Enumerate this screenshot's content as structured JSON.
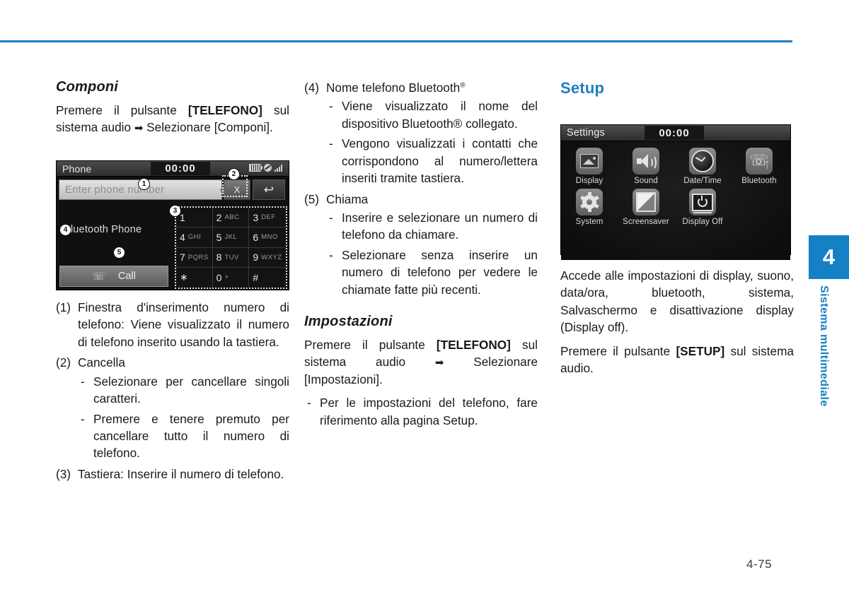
{
  "page": {
    "number": "4-75",
    "accent_color": "#1f7fc0"
  },
  "chapter_tab": {
    "number": "4",
    "label": "Sistema multimediale"
  },
  "col1": {
    "heading": "Componi",
    "intro_1": "Premere il pulsante ",
    "intro_bold": "[TELEFONO]",
    "intro_2": " sul sistema audio ",
    "intro_arrow": "➡",
    "intro_3": " Selezionare [Componi].",
    "items": [
      {
        "marker": "(1)",
        "text": "Finestra d'inserimento numero di telefono: Viene visualizzato il numero di telefono inserito usando la tastiera."
      },
      {
        "marker": "(2)",
        "text": "Cancella",
        "subitems": [
          "Selezionare per cancellare singoli caratteri.",
          "Premere e tenere premuto per cancellare tutto il numero di telefono."
        ]
      },
      {
        "marker": "(3)",
        "text": "Tastiera: Inserire il numero di telefono."
      }
    ]
  },
  "col2": {
    "items": [
      {
        "marker": "(4)",
        "text": "Nome telefono Bluetooth",
        "sup": "®",
        "subitems": [
          "Viene visualizzato il nome del dispositivo Bluetooth® collegato.",
          "Vengono visualizzati i contatti che corrispondono al numero/lettera inseriti tramite tastiera."
        ]
      },
      {
        "marker": "(5)",
        "text": "Chiama",
        "subitems": [
          "Inserire e selezionare un numero di telefono da chiamare.",
          "Selezionare senza inserire un numero di telefono per vedere le chiamate fatte più recenti."
        ]
      }
    ],
    "heading": "Impostazioni",
    "intro_1": "Premere il pulsante ",
    "intro_bold": "[TELEFONO]",
    "intro_2": " sul sistema audio ",
    "intro_arrow": "➡",
    "intro_3": " Selezionare [Impostazioni].",
    "dash_note": "Per le impostazioni del telefono, fare riferimento alla pagina Setup."
  },
  "col3": {
    "heading": "Setup",
    "para_1": "Accede alle impostazioni di display, suono, data/ora, bluetooth, sistema, Salvaschermo e disattivazione display (Display off).",
    "para_2a": "Premere il pulsante ",
    "para_2bold": "[SETUP]",
    "para_2b": " sul sistema audio."
  },
  "phone_screen": {
    "title": "Phone",
    "clock": "00:00",
    "status_icons": [
      "battery-icon",
      "mute-icon",
      "signal-icon"
    ],
    "input_placeholder": "Enter phone number",
    "clear_label": "X",
    "back_label": "↩",
    "bt_device_label": "Bluetooth Phone",
    "call_label": "Call",
    "call_icon": "handset-icon",
    "keys": [
      {
        "digit": "1",
        "letters": ""
      },
      {
        "digit": "2",
        "letters": "ABC"
      },
      {
        "digit": "3",
        "letters": "DEF"
      },
      {
        "digit": "4",
        "letters": "GHI"
      },
      {
        "digit": "5",
        "letters": "JKL"
      },
      {
        "digit": "6",
        "letters": "MNO"
      },
      {
        "digit": "7",
        "letters": "PQRS"
      },
      {
        "digit": "8",
        "letters": "TUV"
      },
      {
        "digit": "9",
        "letters": "WXYZ"
      },
      {
        "digit": "∗",
        "letters": ""
      },
      {
        "digit": "0",
        "letters": "+"
      },
      {
        "digit": "#",
        "letters": ""
      }
    ],
    "callouts": [
      "1",
      "2",
      "3",
      "4",
      "5"
    ]
  },
  "settings_screen": {
    "title": "Settings",
    "clock": "00:00",
    "row1": [
      {
        "label": "Display",
        "icon": "picture-icon"
      },
      {
        "label": "Sound",
        "icon": "speaker-icon"
      },
      {
        "label": "Date/Time",
        "icon": "clock-icon"
      },
      {
        "label": "Bluetooth",
        "icon": "bluetooth-phone-icon"
      }
    ],
    "row2": [
      {
        "label": "System",
        "icon": "gear-icon"
      },
      {
        "label": "Screensaver",
        "icon": "screensaver-icon"
      },
      {
        "label": "Display Off",
        "icon": "display-off-icon"
      }
    ]
  }
}
